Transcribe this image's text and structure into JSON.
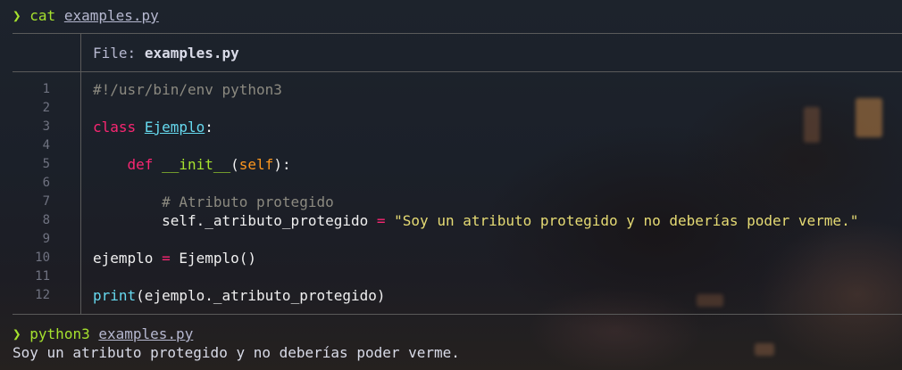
{
  "prompt_symbol": "❯",
  "command1": {
    "cmd": "cat",
    "arg": "examples.py"
  },
  "file_header": {
    "label": "File:",
    "name": "examples.py"
  },
  "line_numbers": [
    "1",
    "2",
    "3",
    "4",
    "5",
    "6",
    "7",
    "8",
    "9",
    "10",
    "11",
    "12"
  ],
  "code": {
    "l1": "#!/usr/bin/env python3",
    "l3_kw": "class",
    "l3_name": "Ejemplo",
    "l3_colon": ":",
    "l5_indent": "    ",
    "l5_kw": "def",
    "l5_fn": "__init__",
    "l5_open": "(",
    "l5_self": "self",
    "l5_close": "):",
    "l7": "        # Atributo protegido",
    "l8_lhs": "        self._atributo_protegido",
    "l8_eq": " = ",
    "l8_str": "\"Soy un atributo protegido y no deberías poder verme.\"",
    "l10_var": "ejemplo",
    "l10_eq": " = ",
    "l10_call": "Ejemplo()",
    "l12_bi": "print",
    "l12_rest": "(ejemplo._atributo_protegido)"
  },
  "command2": {
    "cmd": "python3",
    "arg": "examples.py"
  },
  "output": "Soy un atributo protegido y no deberías poder verme."
}
